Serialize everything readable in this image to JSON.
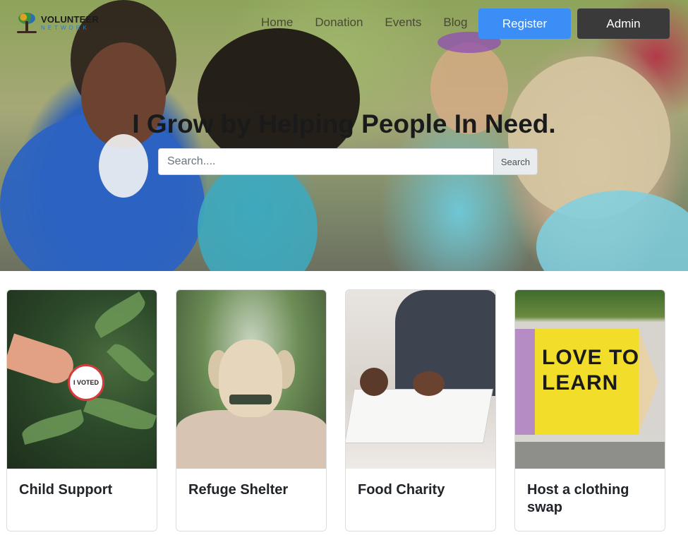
{
  "brand": {
    "line1": "VOLUNTEER",
    "line2": "NETWORK"
  },
  "nav": {
    "items": [
      "Home",
      "Donation",
      "Events",
      "Blog"
    ]
  },
  "actions": {
    "register": "Register",
    "admin": "Admin"
  },
  "hero": {
    "headline": "I Grow by Helping People In Need."
  },
  "search": {
    "placeholder": "Search....",
    "button": "Search"
  },
  "cards": [
    {
      "title": "Child Support",
      "image_badge": "I VOTED"
    },
    {
      "title": "Refuge Shelter"
    },
    {
      "title": "Food Charity"
    },
    {
      "title": "Host a clothing swap",
      "image_text": "LOVE TO LEARN"
    }
  ],
  "colors": {
    "register": "#3c8ef7",
    "admin": "#3a3a3a"
  }
}
